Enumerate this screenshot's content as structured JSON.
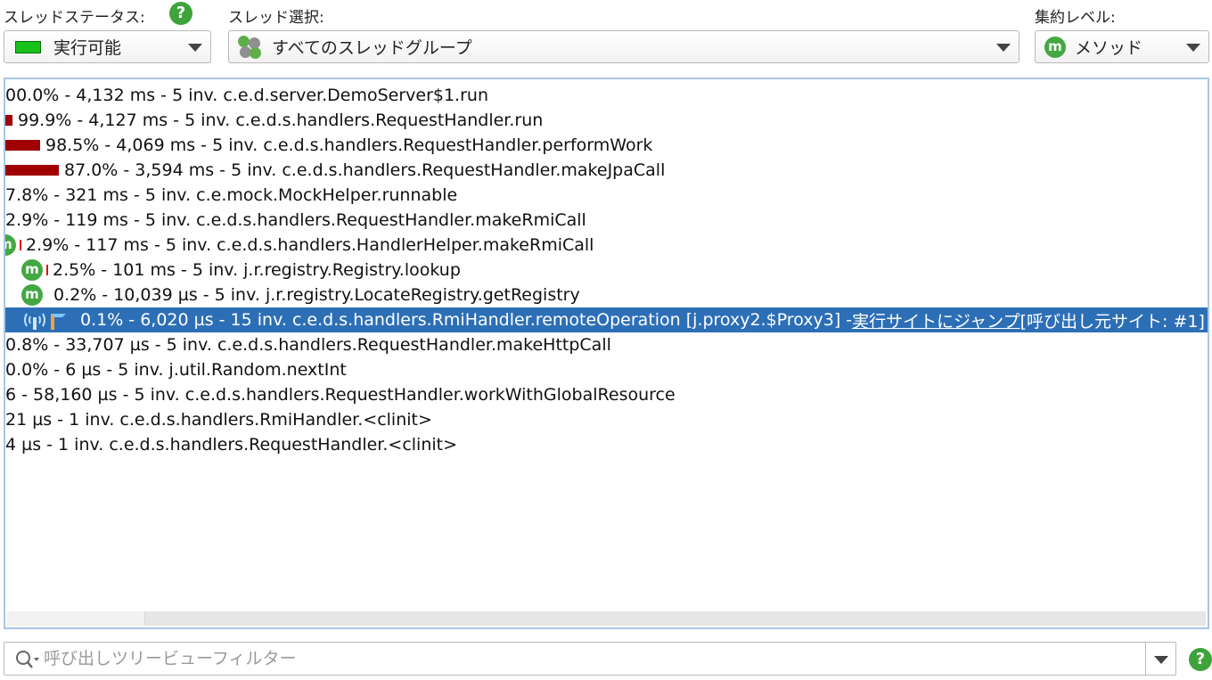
{
  "header": {
    "thread_status_label": "スレッドステータス:",
    "thread_select_label": "スレッド選択:",
    "aggregation_label": "集約レベル:",
    "help_glyph": "?"
  },
  "status_combo": {
    "value": "実行可能",
    "color": "#19c219"
  },
  "thread_combo": {
    "value": "すべてのスレッドグループ"
  },
  "aggregation_combo": {
    "value": "メソッド",
    "icon_glyph": "m"
  },
  "tree": {
    "rows": [
      {
        "text": "00.0% - 4,132 ms - 5 inv. c.e.d.server.DemoServer$1.run"
      },
      {
        "text": "99.9% - 4,127 ms - 5 inv. c.e.d.s.handlers.RequestHandler.run"
      },
      {
        "text": "98.5% - 4,069 ms - 5 inv. c.e.d.s.handlers.RequestHandler.performWork"
      },
      {
        "text": "87.0% - 3,594 ms - 5 inv. c.e.d.s.handlers.RequestHandler.makeJpaCall"
      },
      {
        "text": "7.8% - 321 ms - 5 inv. c.e.mock.MockHelper.runnable"
      },
      {
        "text": "2.9% - 119 ms - 5 inv. c.e.d.s.handlers.RequestHandler.makeRmiCall"
      },
      {
        "text": "2.9% - 117 ms - 5 inv. c.e.d.s.handlers.HandlerHelper.makeRmiCall"
      },
      {
        "text": "2.5% - 101 ms - 5 inv. j.r.registry.Registry.lookup"
      },
      {
        "text": "0.2% - 10,039 µs - 5 inv. j.r.registry.LocateRegistry.getRegistry"
      },
      {
        "text": "0.1% - 6,020 µs - 15 inv. c.e.d.s.handlers.RmiHandler.remoteOperation [j.proxy2.$Proxy3] - ",
        "link": "実行サイトにジャンプ",
        "suffix": " [呼び出し元サイト: #1]"
      },
      {
        "text": "0.8% - 33,707 µs - 5 inv. c.e.d.s.handlers.RequestHandler.makeHttpCall"
      },
      {
        "text": "0.0% - 6 µs - 5 inv. j.util.Random.nextInt"
      },
      {
        "text": "6 - 58,160 µs - 5 inv. c.e.d.s.handlers.RequestHandler.workWithGlobalResource"
      },
      {
        "text": "21 µs - 1 inv. c.e.d.s.handlers.RmiHandler.<clinit>"
      },
      {
        "text": "4 µs - 1 inv. c.e.d.s.handlers.RequestHandler.<clinit>"
      }
    ]
  },
  "filter": {
    "placeholder": "呼び出しツリービューフィルター",
    "value": ""
  },
  "colors": {
    "selection": "#2d6fb6",
    "bar": "#a00000",
    "accent_green": "#3fa33c"
  }
}
